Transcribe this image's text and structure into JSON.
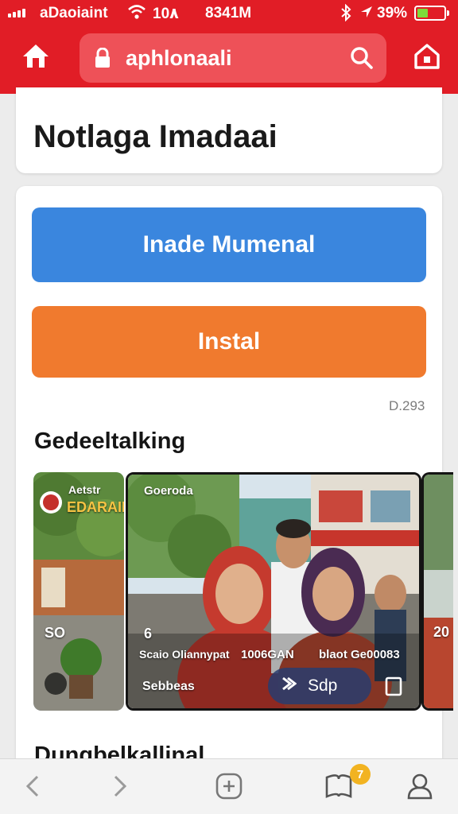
{
  "status_bar": {
    "carrier": "aDaoiaint",
    "signal_strength": "4 of 4 bars",
    "center_text": "10۸",
    "time": "8341M",
    "battery_percent": "39%",
    "battery_level": 0.39,
    "icons": [
      "wifi-icon",
      "bluetooth-icon",
      "location-icon",
      "battery-icon"
    ]
  },
  "browser": {
    "url": "aphlonaali",
    "icons": [
      "home-icon",
      "lock-icon",
      "search-icon",
      "home-outline-icon"
    ],
    "accent_color": "#e11d26"
  },
  "page": {
    "title": "Notlaga Imadaai",
    "primary_button": "Inade Mumenal",
    "secondary_button": "Instal",
    "meta_text": "D.293",
    "section_title": "Gedeeltalking",
    "next_section_title": "Dungbelkallinal",
    "colors": {
      "primary": "#3a86de",
      "secondary": "#f07a2e"
    }
  },
  "tiles": {
    "left": {
      "top_label": "Aetstr",
      "banner": "EDARAIN",
      "count": "SO"
    },
    "main": {
      "top_label": "Goeroda",
      "likes": "6",
      "caption_left": "Scaio Oliannypat",
      "caption_mid": "1006GAN",
      "caption_right": "blaot Ge00083",
      "location_label": "Sebbeas",
      "pill_label": "Sdp"
    },
    "right": {
      "count": "20"
    }
  },
  "bottom_nav": {
    "items": [
      "back-icon",
      "forward-icon",
      "new-tab-icon",
      "bookmarks-icon",
      "profile-icon"
    ],
    "badge_count": "7"
  }
}
